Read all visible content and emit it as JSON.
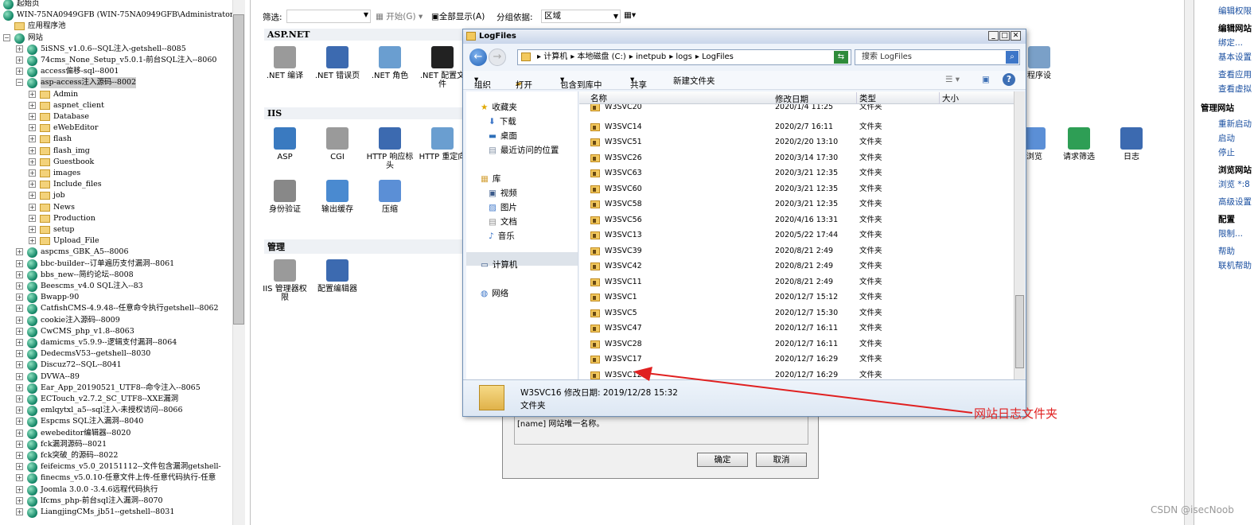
{
  "tree": {
    "start_page": "起始页",
    "server": "WIN-75NA0949GFB (WIN-75NA0949GFB\\Administrator)",
    "app_pools": "应用程序池",
    "sites": "网站",
    "top_sites": [
      "5iSNS_v1.0.6--SQL注入-getshell--8085",
      "74cms_None_Setup_v5.0.1-前台SQL注入--8060",
      "access偏移-sql--8001",
      "asp-access注入源码--8002"
    ],
    "folders": [
      "Admin",
      "aspnet_client",
      "Database",
      "eWebEditor",
      "flash",
      "flash_img",
      "Guestbook",
      "images",
      "Include_files",
      "job",
      "News",
      "Production",
      "setup",
      "Upload_File"
    ],
    "bottom_sites": [
      "aspcms_GBK_A5--8006",
      "bbc-builder--订单遍历支付漏洞--8061",
      "bbs_new--简约论坛--8008",
      "Beescms_v4.0 SQL注入--83",
      "Bwapp-90",
      "CatfishCMS-4.9.48--任意命令执行getshell--8062",
      "cookie注入源码--8009",
      "CwCMS_php_v1.8--8063",
      "damicms_v5.9.9--逻辑支付漏洞--8064",
      "DedecmsV53--getshell--8030",
      "Discuz72--SQL--8041",
      "DVWA--89",
      "Ear_App_20190521_UTF8--命令注入--8065",
      "ECTouch_v2.7.2_SC_UTF8--XXE漏洞",
      "emlqytxl_a5--sql注入-未授权访问--8066",
      "Espcms SQL注入漏洞--8040",
      "ewebeditor编辑器--8020",
      "fck漏洞源码--8021",
      "fck突破_的源码--8022",
      "feifeicms_v5.0_20151112--文件包含漏洞getshell-",
      "finecms_v5.0.10-任意文件上传-任意代码执行-任意",
      "Joomla 3.0.0 -3.4.6远程代码执行",
      "lfcms_php-前台sql注入漏洞--8070",
      "LiangjingCMs_jb51--getshell--8031"
    ]
  },
  "filter": {
    "label": "筛选:",
    "start": "开始(G)",
    "show_all": "全部显示(A)",
    "group_by": "分组依据:",
    "group_value": "区域"
  },
  "sections": {
    "aspnet": "ASP.NET",
    "iis": "IIS",
    "manage": "管理"
  },
  "aspnet_icons": [
    ".NET 编译",
    ".NET 错误页",
    ".NET 角色",
    ".NET 配置文件"
  ],
  "iis_icons": [
    "ASP",
    "CGI",
    "HTTP 响应标头",
    "HTTP 重定向"
  ],
  "iis_icons2": [
    "身份验证",
    "输出缓存",
    "压缩"
  ],
  "manage_icons": [
    "IIS 管理器权限",
    "配置编辑器"
  ],
  "right_icons": [
    "程序设",
    "浏览",
    "请求筛选",
    "日志"
  ],
  "right_pane": {
    "edit_perm": "编辑权限",
    "edit_site": "编辑网站",
    "bind": "绑定...",
    "basic": "基本设置",
    "view_app": "查看应用",
    "view_vdir": "查看虚拟",
    "manage_site": "管理网站",
    "restart": "重新启动",
    "start": "启动",
    "stop": "停止",
    "browse_site": "浏览网站",
    "browse": "浏览 *:8",
    "advanced": "高级设置",
    "config": "配置",
    "limits": "限制...",
    "help": "帮助",
    "online_help": "联机帮助"
  },
  "explorer": {
    "title": "LogFiles",
    "breadcrumb": [
      "计算机",
      "本地磁盘 (C:)",
      "inetpub",
      "logs",
      "LogFiles"
    ],
    "search_placeholder": "搜索 LogFiles",
    "toolbar": {
      "organize": "组织",
      "open": "打开",
      "include": "包含到库中",
      "share": "共享",
      "new_folder": "新建文件夹"
    },
    "nav": {
      "favorites": "收藏夹",
      "downloads": "下载",
      "desktop": "桌面",
      "recent": "最近访问的位置",
      "libraries": "库",
      "videos": "视频",
      "pictures": "图片",
      "docs": "文档",
      "music": "音乐",
      "computer": "计算机",
      "network": "网络"
    },
    "columns": {
      "name": "名称",
      "date": "修改日期",
      "type": "类型",
      "size": "大小"
    },
    "files": [
      {
        "name": "W3SVC20",
        "date": "2020/1/4 11:25",
        "type": "文件夹"
      },
      {
        "name": "W3SVC14",
        "date": "2020/2/7 16:11",
        "type": "文件夹"
      },
      {
        "name": "W3SVC51",
        "date": "2020/2/20 13:10",
        "type": "文件夹"
      },
      {
        "name": "W3SVC26",
        "date": "2020/3/14 17:30",
        "type": "文件夹"
      },
      {
        "name": "W3SVC63",
        "date": "2020/3/21 12:35",
        "type": "文件夹"
      },
      {
        "name": "W3SVC60",
        "date": "2020/3/21 12:35",
        "type": "文件夹"
      },
      {
        "name": "W3SVC58",
        "date": "2020/3/21 12:35",
        "type": "文件夹"
      },
      {
        "name": "W3SVC56",
        "date": "2020/4/16 13:31",
        "type": "文件夹"
      },
      {
        "name": "W3SVC13",
        "date": "2020/5/22 17:44",
        "type": "文件夹"
      },
      {
        "name": "W3SVC39",
        "date": "2020/8/21 2:49",
        "type": "文件夹"
      },
      {
        "name": "W3SVC42",
        "date": "2020/8/21 2:49",
        "type": "文件夹"
      },
      {
        "name": "W3SVC11",
        "date": "2020/8/21 2:49",
        "type": "文件夹"
      },
      {
        "name": "W3SVC1",
        "date": "2020/12/7 15:12",
        "type": "文件夹"
      },
      {
        "name": "W3SVC5",
        "date": "2020/12/7 15:30",
        "type": "文件夹"
      },
      {
        "name": "W3SVC47",
        "date": "2020/12/7 16:11",
        "type": "文件夹"
      },
      {
        "name": "W3SVC28",
        "date": "2020/12/7 16:11",
        "type": "文件夹"
      },
      {
        "name": "W3SVC17",
        "date": "2020/12/7 16:29",
        "type": "文件夹"
      },
      {
        "name": "W3SVC12",
        "date": "2020/12/7 16:29",
        "type": "文件夹"
      }
    ],
    "detail": {
      "line1": "W3SVC16 修改日期: 2019/12/28 15:32",
      "line2": "文件夹"
    }
  },
  "behind_dialog": {
    "text": "[name] 网站唯一名称。",
    "ok": "确定",
    "cancel": "取消"
  },
  "annotation": "网站日志文件夹",
  "watermark": "CSDN @isecNoob"
}
